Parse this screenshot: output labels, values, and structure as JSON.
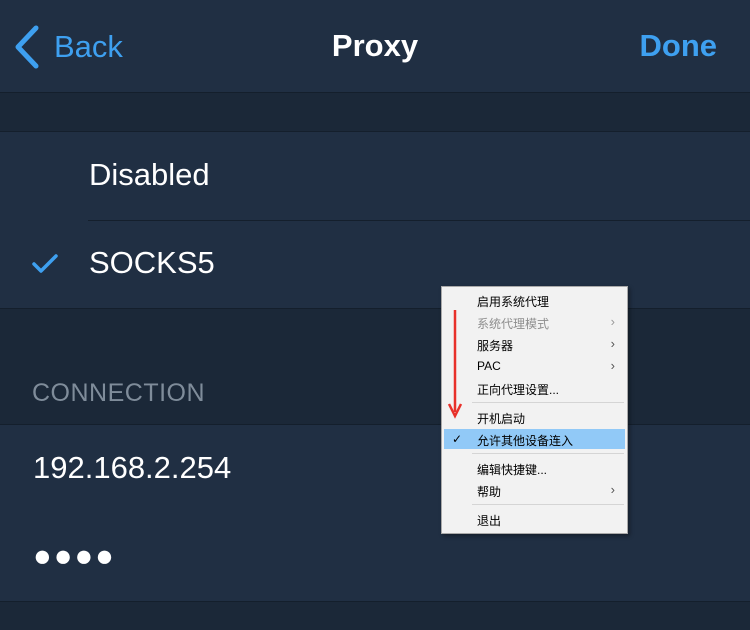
{
  "navbar": {
    "back_label": "Back",
    "title": "Proxy",
    "done_label": "Done"
  },
  "proxy_options": [
    {
      "label": "Disabled",
      "selected": false
    },
    {
      "label": "SOCKS5",
      "selected": true
    }
  ],
  "connection": {
    "header": "CONNECTION",
    "server": "192.168.2.254",
    "password_masked": "●●●●"
  },
  "context_menu": {
    "items": [
      {
        "label": "启用系统代理"
      },
      {
        "label": "系统代理模式",
        "submenu_arrow": "›",
        "disabled": true
      },
      {
        "label": "服务器",
        "submenu_arrow": "›"
      },
      {
        "label": "PAC",
        "submenu_arrow": "›"
      },
      {
        "label": "正向代理设置..."
      },
      {
        "label": "开机启动"
      },
      {
        "label": "允许其他设备连入",
        "checked": true,
        "check_glyph": "✓",
        "highlighted": true
      },
      {
        "label": "编辑快捷键..."
      },
      {
        "label": "帮助",
        "submenu_arrow": "›"
      },
      {
        "label": "退出"
      }
    ]
  },
  "colors": {
    "accent": "#3ea0f0",
    "annotation_arrow": "#e8312a",
    "menu_highlight": "#91c9f7"
  }
}
